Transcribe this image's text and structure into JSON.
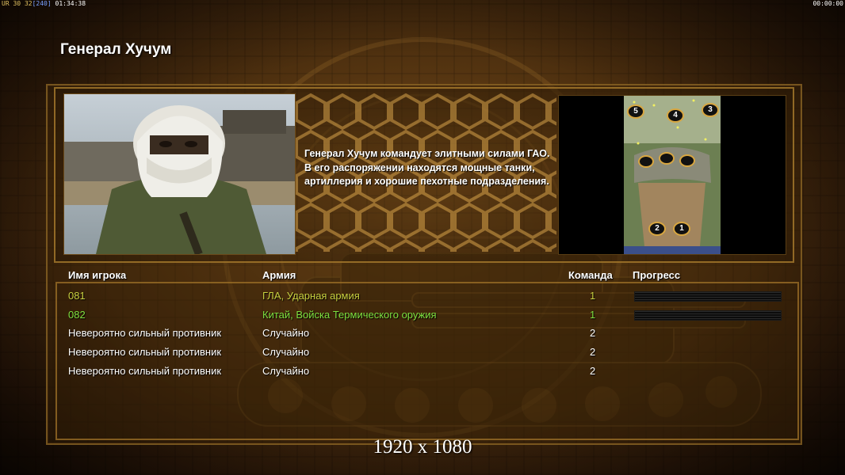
{
  "hud": {
    "left_a": "UR",
    "left_b": "30",
    "left_c": "32",
    "left_d": "[240]",
    "left_time": "01:34:38",
    "right_time": "00:00:00"
  },
  "title": "Генерал Хучум",
  "description": "Генерал Хучум командует элитными силами ГАО. В его распоряжении находятся мощные танки, артиллерия и хорошие пехотные подразделения.",
  "map": {
    "start_positions": [
      "1",
      "2",
      "3",
      "4",
      "5"
    ]
  },
  "table": {
    "headers": {
      "player": "Имя игрока",
      "army": "Армия",
      "team": "Команда",
      "progress": "Прогресс"
    },
    "rows": [
      {
        "name": "081",
        "army": "ГЛА, Ударная армия",
        "team": "1",
        "color": "#c8d040",
        "has_progress": true
      },
      {
        "name": "082",
        "army": "Китай, Войска Термического оружия",
        "team": "1",
        "color": "#7ee040",
        "has_progress": true
      },
      {
        "name": "Невероятно сильный противник",
        "army": "Случайно",
        "team": "2",
        "color": "#ffffff",
        "has_progress": false
      },
      {
        "name": "Невероятно сильный противник",
        "army": "Случайно",
        "team": "2",
        "color": "#ffffff",
        "has_progress": false
      },
      {
        "name": "Невероятно сильный противник",
        "army": "Случайно",
        "team": "2",
        "color": "#ffffff",
        "has_progress": false
      }
    ]
  },
  "resolution_label": "1920 x 1080"
}
